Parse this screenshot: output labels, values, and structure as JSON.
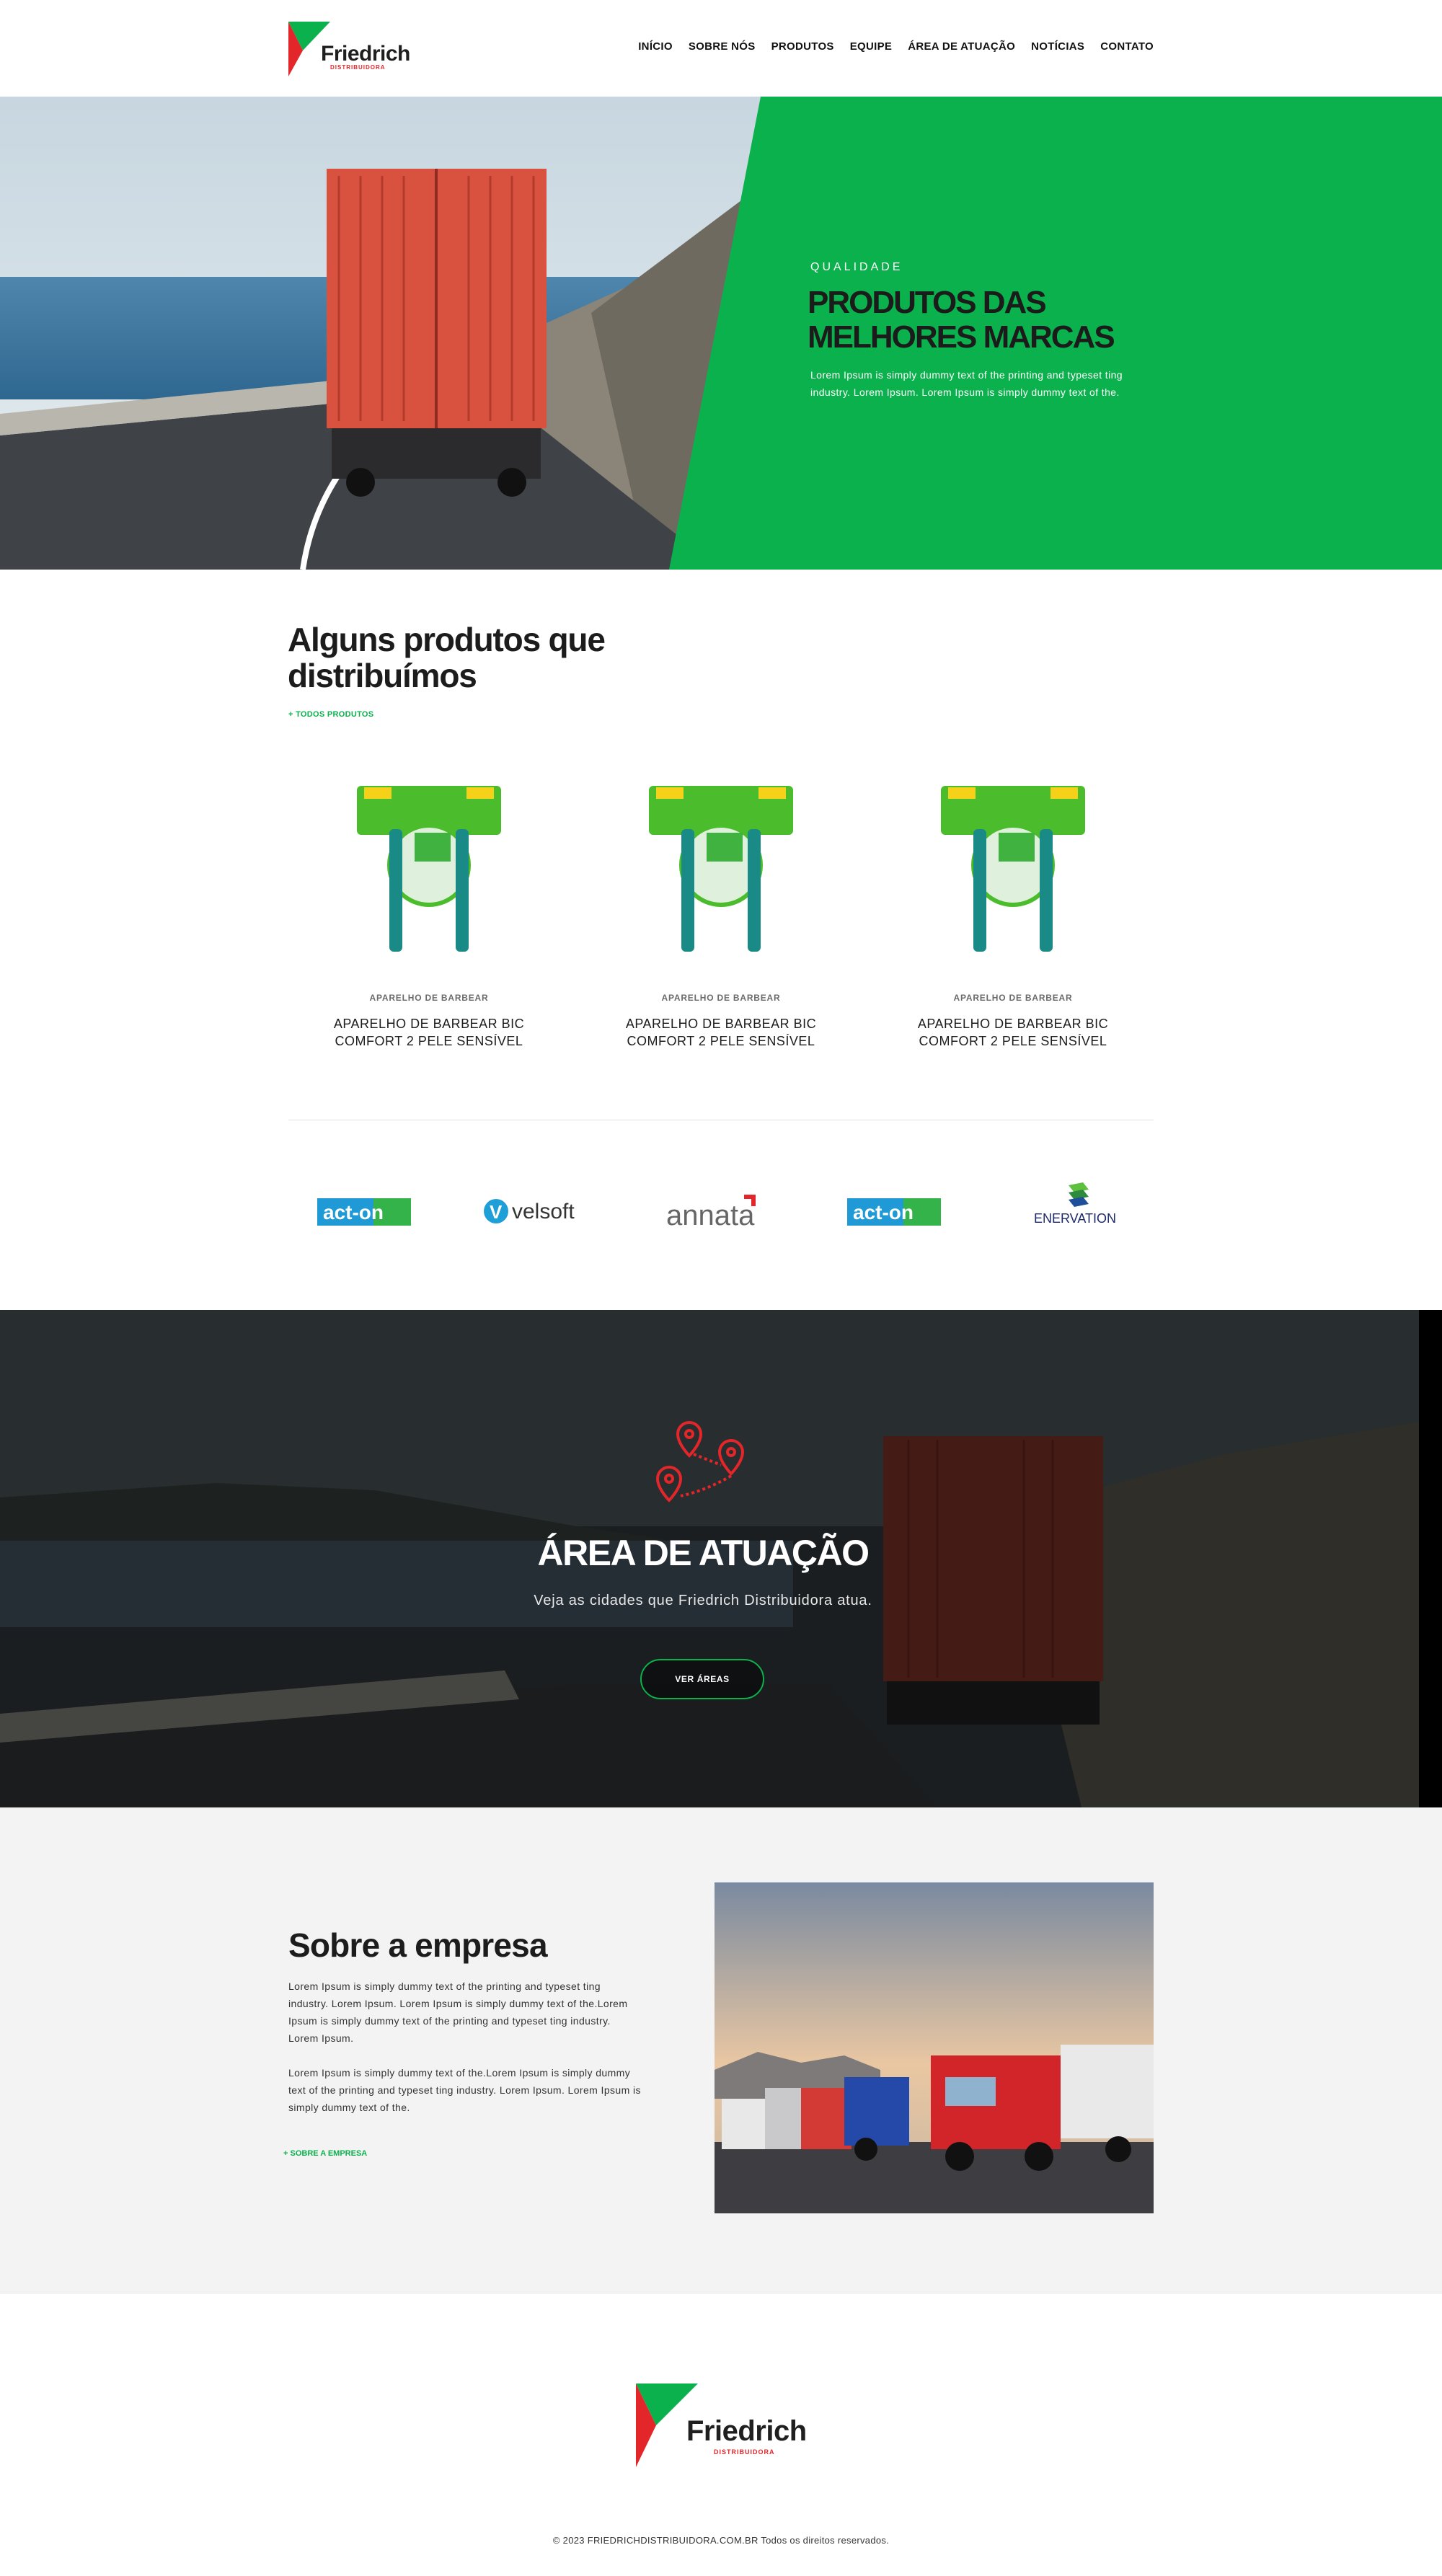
{
  "header": {
    "logo_name": "Friedrich",
    "logo_sub": "DISTRIBUIDORA",
    "nav": [
      "INÍCIO",
      "SOBRE NÓS",
      "PRODUTOS",
      "EQUIPE",
      "ÁREA DE ATUAÇÃO",
      "NOTÍCIAS",
      "CONTATO"
    ]
  },
  "hero": {
    "kicker": "QUALIDADE",
    "title": "PRODUTOS DAS MELHORES MARCAS",
    "text": "Lorem Ipsum is simply dummy text of the printing and typeset ting industry. Lorem Ipsum. Lorem Ipsum is simply dummy text of the."
  },
  "products": {
    "title": "Alguns produtos que distribuímos",
    "link": "+ TODOS PRODUTOS",
    "items": [
      {
        "category": "APARELHO DE BARBEAR",
        "name": "APARELHO DE BARBEAR BIC COMFORT 2 PELE SENSÍVEL"
      },
      {
        "category": "APARELHO DE BARBEAR",
        "name": "APARELHO DE BARBEAR BIC COMFORT 2 PELE SENSÍVEL"
      },
      {
        "category": "APARELHO DE BARBEAR",
        "name": "APARELHO DE BARBEAR BIC COMFORT 2 PELE SENSÍVEL"
      }
    ]
  },
  "brands": [
    "act-on",
    "velsoft",
    "annata",
    "act-on",
    "ENERVATION"
  ],
  "area": {
    "title": "ÁREA DE ATUAÇÃO",
    "subtitle": "Veja as cidades que Friedrich Distribuidora atua.",
    "button": "VER ÁREAS"
  },
  "about": {
    "title": "Sobre a empresa",
    "p1": "Lorem Ipsum is simply dummy text of the printing and typeset ting industry. Lorem Ipsum. Lorem Ipsum is simply dummy text of the.Lorem Ipsum is simply dummy text of the printing and typeset ting industry. Lorem Ipsum.",
    "p2": "Lorem Ipsum is simply dummy text of the.Lorem Ipsum is simply dummy text of the printing and typeset ting industry. Lorem Ipsum. Lorem Ipsum is simply dummy text of the.",
    "link": "+ SOBRE A EMPRESA"
  },
  "footer": {
    "logo_name": "Friedrich",
    "logo_sub": "DISTRIBUIDORA",
    "copyright": "© 2023 FRIEDRICHDISTRIBUIDORA.COM.BR Todos os direitos reservados."
  },
  "colors": {
    "accent": "#0bb14c",
    "brand_red": "#e3262a",
    "dark": "#1c1c1c"
  }
}
